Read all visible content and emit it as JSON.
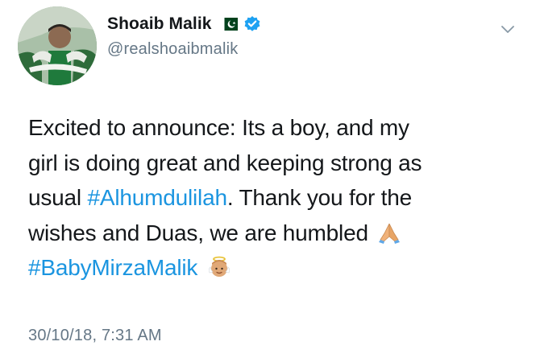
{
  "author": {
    "display_name": "Shoaib Malik",
    "handle": "@realshoaibmalik",
    "verified": true,
    "flag_icon": "pakistan-flag-icon",
    "avatar_icon": "profile-avatar"
  },
  "tweet": {
    "lines": [
      [
        {
          "text": "Excited to announce: Its a boy, and my",
          "type": "text"
        }
      ],
      [
        {
          "text": "girl is doing great and keeping strong as",
          "type": "text"
        }
      ],
      [
        {
          "text": "usual ",
          "type": "text"
        },
        {
          "text": "#Alhumdulilah",
          "type": "hashtag"
        },
        {
          "text": ". Thank you for the",
          "type": "text"
        }
      ],
      [
        {
          "text": "wishes and Duas, we are humbled",
          "type": "text"
        }
      ],
      [
        {
          "text": "#BabyMirzaMalik",
          "type": "hashtag"
        }
      ]
    ],
    "emojis": [
      "folded-hands-emoji",
      "baby-angel-emoji"
    ],
    "timestamp": "30/10/18, 7:31 AM"
  },
  "colors": {
    "text": "#14171a",
    "secondary": "#657786",
    "link": "#1b95e0",
    "verified": "#1da1f2",
    "flag_green": "#01411c"
  },
  "menu_icon": "chevron-down-icon"
}
